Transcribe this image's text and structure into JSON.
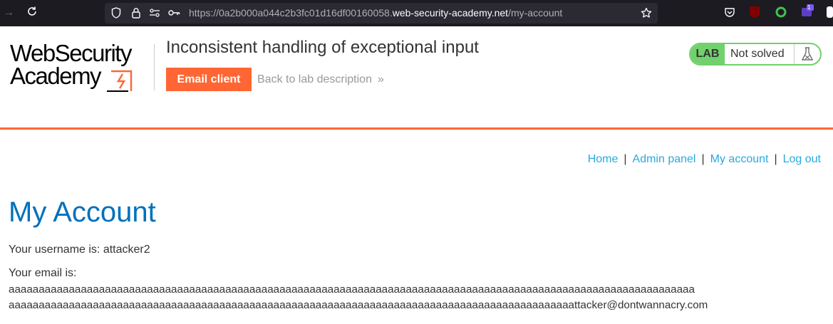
{
  "browser": {
    "url_prefix": "https://0a2b000a044c2b3fc01d16df00160058.",
    "url_host": "web-security-academy.net",
    "url_path": "/my-account",
    "extension_badge": "1"
  },
  "logo": {
    "line1": "WebSecurity",
    "line2": "Academy"
  },
  "lab": {
    "title": "Inconsistent handling of exceptional input",
    "email_client_label": "Email client",
    "back_link_label": "Back to lab description",
    "back_link_chevron": "»",
    "badge_label": "LAB",
    "status": "Not solved"
  },
  "nav": {
    "home": "Home",
    "admin_panel": "Admin panel",
    "my_account": "My account",
    "log_out": "Log out",
    "separator": "|"
  },
  "account": {
    "heading": "My Account",
    "username_line": "Your username is: attacker2",
    "email_label": "Your email is:",
    "email_line1": "aaaaaaaaaaaaaaaaaaaaaaaaaaaaaaaaaaaaaaaaaaaaaaaaaaaaaaaaaaaaaaaaaaaaaaaaaaaaaaaaaaaaaaaaaaaaaaaaaaaaaaaaaaaaaaaaaa",
    "email_line2": "aaaaaaaaaaaaaaaaaaaaaaaaaaaaaaaaaaaaaaaaaaaaaaaaaaaaaaaaaaaaaaaaaaaaaaaaaaaaaaaaaaaaaaaaaaaaaattacker@dontwannacry.com"
  },
  "colors": {
    "accent_orange": "#ff6633",
    "link_blue": "#29a9e0",
    "heading_blue": "#0071bc",
    "lab_green": "#70d16d"
  }
}
